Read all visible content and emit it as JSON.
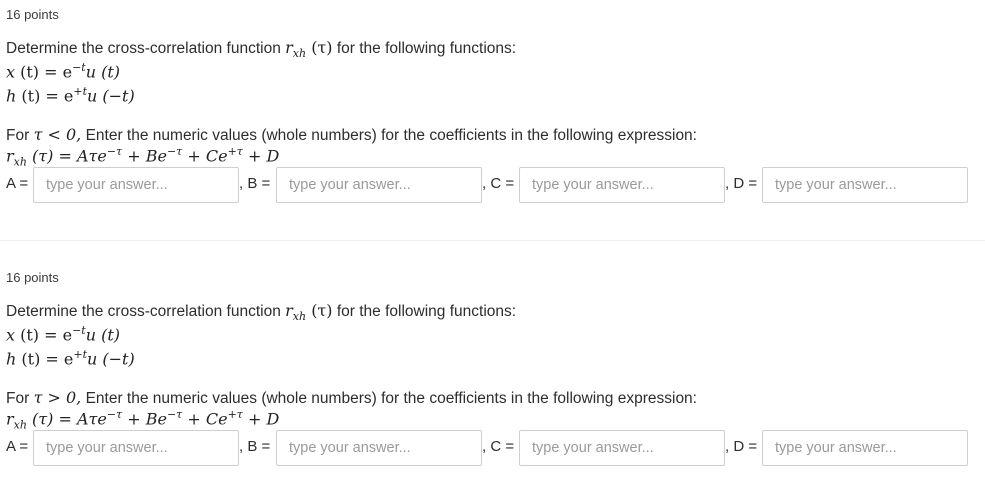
{
  "questions": [
    {
      "points": "16 points",
      "prompt": "Determine the cross-correlation function",
      "prompt_tail": "for the following functions:",
      "rxh": "(τ)",
      "x_def": "(t) = e",
      "x_exp": "−t",
      "x_tail": "u (t)",
      "h_def": "(t) = e",
      "h_exp": "+t",
      "h_tail": "u (−t)",
      "condition_prefix": "For",
      "condition_symbol": "τ < 0,",
      "condition_text": "Enter the numeric values (whole numbers) for the coefficients in the following expression:",
      "expression": "(τ) = Aτe",
      "exp1": "−τ",
      "expr_mid": " + Be",
      "exp2": "−τ",
      "expr_mid2": " + Ce",
      "exp3": "+τ",
      "expr_end": " + D",
      "answers": [
        {
          "label": "A =",
          "placeholder": "type your answer..."
        },
        {
          "label": ", B =",
          "placeholder": "type your answer..."
        },
        {
          "label": ", C =",
          "placeholder": "type your answer..."
        },
        {
          "label": ", D =",
          "placeholder": "type your answer..."
        }
      ]
    },
    {
      "points": "16 points",
      "prompt": "Determine the cross-correlation function",
      "prompt_tail": "for the following functions:",
      "rxh": "(τ)",
      "x_def": "(t) = e",
      "x_exp": "−t",
      "x_tail": "u (t)",
      "h_def": "(t) = e",
      "h_exp": "+t",
      "h_tail": "u (−t)",
      "condition_prefix": "For",
      "condition_symbol": "τ > 0,",
      "condition_text": "Enter the numeric values (whole numbers) for the coefficients in the following expression:",
      "expression": "(τ) = Aτe",
      "exp1": "−τ",
      "expr_mid": " + Be",
      "exp2": "−τ",
      "expr_mid2": " + Ce",
      "exp3": "+τ",
      "expr_end": " + D",
      "answers": [
        {
          "label": "A =",
          "placeholder": "type your answer..."
        },
        {
          "label": ", B =",
          "placeholder": "type your answer..."
        },
        {
          "label": ", C =",
          "placeholder": "type your answer..."
        },
        {
          "label": ", D =",
          "placeholder": "type your answer..."
        }
      ]
    }
  ]
}
